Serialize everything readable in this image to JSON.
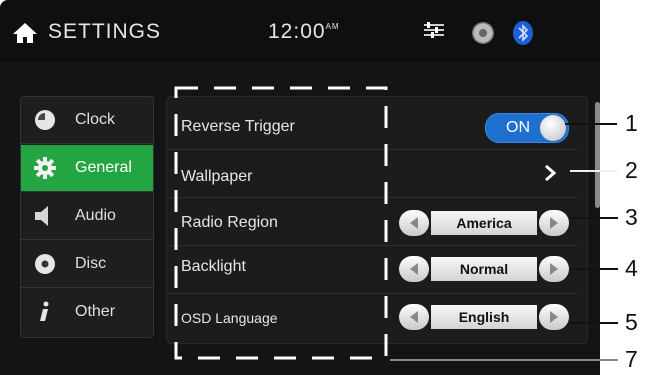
{
  "header": {
    "title": "SETTINGS",
    "time": "12:00",
    "time_suffix": "AM"
  },
  "sidebar": {
    "items": [
      {
        "label": "Clock"
      },
      {
        "label": "General"
      },
      {
        "label": "Audio"
      },
      {
        "label": "Disc"
      },
      {
        "label": "Other"
      }
    ],
    "active": "General"
  },
  "settings": {
    "reverse_trigger": {
      "label": "Reverse Trigger",
      "value": "ON"
    },
    "wallpaper": {
      "label": "Wallpaper"
    },
    "radio_region": {
      "label": "Radio Region",
      "value": "America"
    },
    "backlight": {
      "label": "Backlight",
      "value": "Normal"
    },
    "osd_language": {
      "label": "OSD Language",
      "value": "English"
    }
  },
  "callouts": [
    "1",
    "2",
    "3",
    "4",
    "5",
    "7"
  ],
  "colors": {
    "active_tab": "#22a542",
    "toggle_on": "#1e6fd0",
    "bluetooth": "#1f5fd6",
    "background": "#141414"
  }
}
